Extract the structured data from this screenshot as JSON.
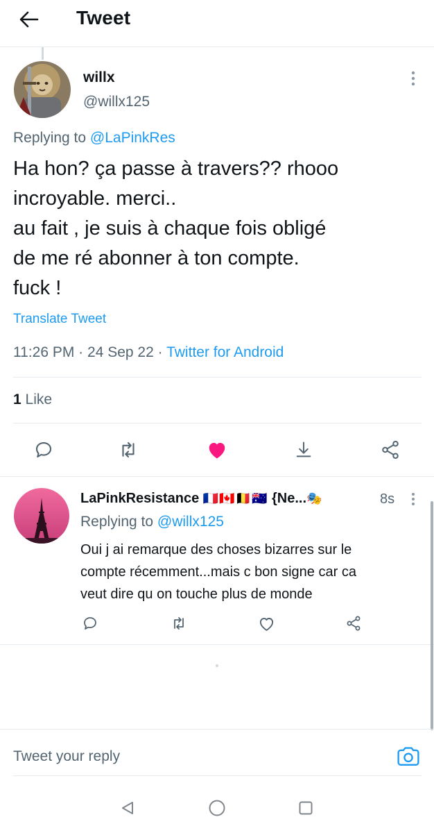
{
  "header": {
    "title": "Tweet",
    "back_icon": "arrow-left-icon"
  },
  "tweet": {
    "author_name": "willx",
    "author_handle": "@willx125",
    "replying_prefix": "Replying to",
    "replying_to": "@LaPinkRes",
    "body_lines": [
      "Ha hon? ça passe à travers?? rhooo",
      "incroyable. merci..",
      "au fait , je suis à chaque fois obligé",
      "de me ré abonner à ton compte.",
      "fuck !"
    ],
    "translate_label": "Translate Tweet",
    "time": "11:26 PM",
    "separator": "·",
    "date": "24 Sep 22",
    "source": "Twitter for Android",
    "like_count": "1",
    "like_label": "Like",
    "liked": true,
    "like_color": "#f91880"
  },
  "reply": {
    "author_name": "LaPinkResistance",
    "flags": "🇫🇷🇨🇦🇧🇪🇦🇺",
    "name_suffix": "{Ne...",
    "masks_emoji": "🎭",
    "time": "8s",
    "replying_prefix": "Replying to",
    "replying_to": "@willx125",
    "body_lines": [
      "Oui j ai remarque des choses bizarres sur le",
      "compte récemment...mais c bon signe car ca",
      "veut dire qu on touche plus de monde"
    ]
  },
  "compose": {
    "placeholder": "Tweet your reply",
    "camera_icon": "camera-icon"
  },
  "colors": {
    "accent": "#1d9bf0",
    "secondary_text": "#536471",
    "like": "#f91880",
    "icon": "#536471"
  }
}
